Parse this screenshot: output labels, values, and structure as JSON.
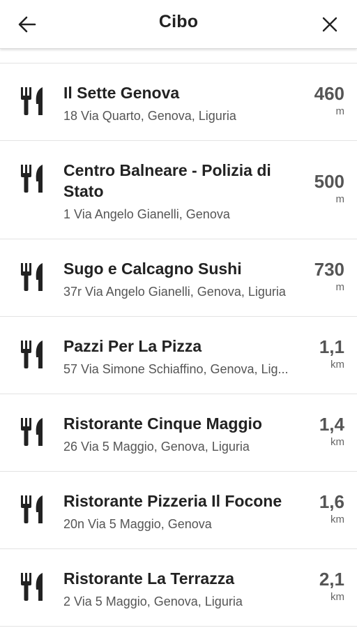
{
  "header": {
    "title": "Cibo",
    "back_icon": "arrow-left-icon",
    "close_icon": "close-icon"
  },
  "places": [
    {
      "name": "Il Sette Genova",
      "address": "18 Via Quarto, Genova, Liguria",
      "distance": "460",
      "unit": "m",
      "icon": "restaurant-icon"
    },
    {
      "name": "Centro Balneare - Polizia di Stato",
      "address": "1 Via Angelo Gianelli, Genova",
      "distance": "500",
      "unit": "m",
      "icon": "restaurant-icon"
    },
    {
      "name": "Sugo e Calcagno Sushi",
      "address": "37r Via Angelo Gianelli, Genova, Liguria",
      "distance": "730",
      "unit": "m",
      "icon": "restaurant-icon"
    },
    {
      "name": "Pazzi Per La Pizza",
      "address": "57 Via Simone Schiaffino, Genova, Lig...",
      "distance": "1,1",
      "unit": "km",
      "icon": "restaurant-icon"
    },
    {
      "name": "Ristorante Cinque Maggio",
      "address": "26 Via 5 Maggio, Genova, Liguria",
      "distance": "1,4",
      "unit": "km",
      "icon": "restaurant-icon"
    },
    {
      "name": "Ristorante Pizzeria Il Focone",
      "address": "20n Via 5 Maggio, Genova",
      "distance": "1,6",
      "unit": "km",
      "icon": "restaurant-icon"
    },
    {
      "name": "Ristorante La Terrazza",
      "address": "2 Via 5 Maggio, Genova, Liguria",
      "distance": "2,1",
      "unit": "km",
      "icon": "restaurant-icon"
    }
  ]
}
